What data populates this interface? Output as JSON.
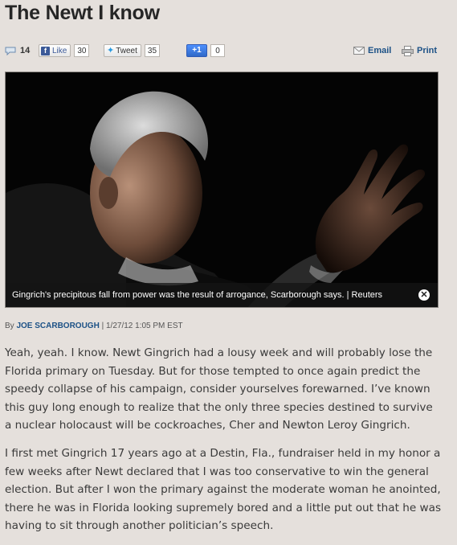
{
  "article": {
    "title": "The Newt I know"
  },
  "share": {
    "comments_count": "14",
    "facebook_label": "Like",
    "facebook_count": "30",
    "twitter_label": "Tweet",
    "twitter_count": "35",
    "gplus_label": "+1",
    "gplus_count": "0",
    "email_label": "Email",
    "print_label": "Print"
  },
  "photo": {
    "caption": "Gingrich's precipitous fall from power was the result of arrogance, Scarborough says. | Reuters"
  },
  "byline": {
    "prefix": "By",
    "author": "JOE SCARBOROUGH",
    "separator": "|",
    "timestamp": "1/27/12 1:05 PM EST"
  },
  "body": {
    "paragraphs": [
      "Yeah, yeah. I know. Newt Gingrich had a lousy week and will probably lose the Florida primary on Tuesday. But for those tempted to once again predict the speedy collapse of his campaign, consider yourselves forewarned. I’ve known this guy long enough to realize that the only three species destined to survive a nuclear holocaust will be cockroaches, Cher and Newton Leroy Gingrich.",
      "I first met Gingrich 17 years ago at a Destin, Fla., fundraiser held in my honor a few weeks after Newt declared that I was too conservative to win the general election. But after I won the primary against the moderate woman he anointed, there he was in Florida looking supremely bored and a little put out that he was having to sit through another politician’s speech."
    ]
  }
}
